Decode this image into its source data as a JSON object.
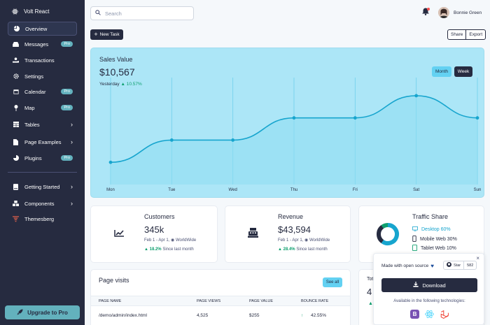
{
  "brand": {
    "name": "Volt React"
  },
  "sidebar": {
    "items": [
      {
        "label": "Overview",
        "icon": "pie-chart-icon"
      },
      {
        "label": "Messages",
        "icon": "inbox-icon",
        "badge": "Pro"
      },
      {
        "label": "Transactions",
        "icon": "hand-holding-icon"
      },
      {
        "label": "Settings",
        "icon": "gear-icon"
      },
      {
        "label": "Calendar",
        "icon": "calendar-icon",
        "badge": "Pro"
      },
      {
        "label": "Map",
        "icon": "map-pin-icon",
        "badge": "Pro"
      },
      {
        "label": "Tables",
        "icon": "table-icon"
      },
      {
        "label": "Page Examples",
        "icon": "file-icon"
      },
      {
        "label": "Plugins",
        "icon": "chart-pie-icon",
        "badge": "Pro"
      },
      {
        "label": "Getting Started",
        "icon": "book-icon"
      },
      {
        "label": "Components",
        "icon": "boxes-icon"
      },
      {
        "label": "Themesberg",
        "icon": "themesberg-logo-icon"
      }
    ],
    "upgrade_label": "Upgrade to Pro"
  },
  "topbar": {
    "search_placeholder": "Search",
    "user_name": "Bonnie Green"
  },
  "actions": {
    "new_task": "New Task",
    "share": "Share",
    "export": "Export"
  },
  "sales": {
    "title": "Sales Value",
    "value": "$10,567",
    "yesterday_label": "Yesterday",
    "yesterday_change": "10.57%",
    "toggle_month": "Month",
    "toggle_week": "Week"
  },
  "chart_data": {
    "type": "line",
    "categories": [
      "Mon",
      "Tue",
      "Wed",
      "Thu",
      "Fri",
      "Sat",
      "Sun"
    ],
    "values": [
      2,
      4,
      4,
      6,
      6,
      8,
      6
    ],
    "ylim": [
      0,
      9
    ],
    "grid": true
  },
  "customers": {
    "title": "Customers",
    "value": "345k",
    "range": "Feb 1 - Apr 1,",
    "region": "WorldWide",
    "change": "18.2%",
    "since": "Since last month"
  },
  "revenue": {
    "title": "Revenue",
    "value": "$43,594",
    "range": "Feb 1 - Apr 1,",
    "region": "WorldWide",
    "change": "28.4%",
    "since": "Since last month"
  },
  "traffic": {
    "title": "Traffic Share",
    "items": [
      {
        "label": "Desktop 60%",
        "icon": "desktop-icon",
        "value": 60
      },
      {
        "label": "Mobile Web 30%",
        "icon": "mobile-icon",
        "value": 30
      },
      {
        "label": "Tablet Web 10%",
        "icon": "tablet-icon",
        "value": 10
      }
    ]
  },
  "page_visits": {
    "title": "Page visits",
    "see_all": "See all",
    "headers": [
      "PAGE NAME",
      "PAGE VIEWS",
      "PAGE VALUE",
      "BOUNCE RATE"
    ],
    "rows": [
      {
        "name": "/demo/admin/index.html",
        "views": "4,525",
        "value": "$255",
        "bounce": "42.55%"
      }
    ]
  },
  "partial_card": {
    "title": "Tot",
    "value": "4"
  },
  "popup": {
    "made_with": "Made with open source",
    "star_label": "Star",
    "star_count": "582",
    "download_label": "Download",
    "available": "Available in the following technologies:"
  },
  "colors": {
    "sidebar": "#262b40",
    "accent": "#63b1bd",
    "hero": "#ace6f7",
    "success": "#0e9f6e",
    "line": "#17a5ce"
  }
}
